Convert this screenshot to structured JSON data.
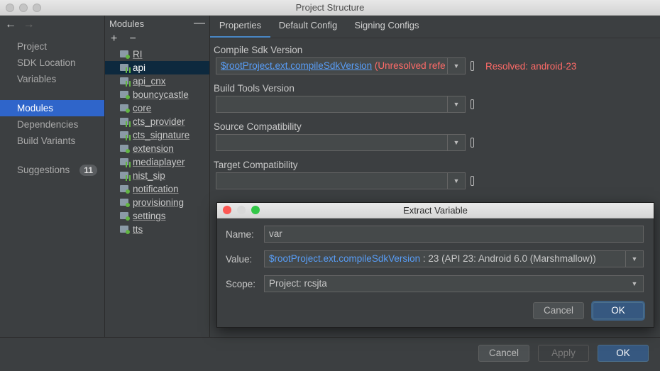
{
  "window": {
    "title": "Project Structure"
  },
  "nav": {
    "back_icon": "arrow-left-icon",
    "forward_icon": "arrow-right-icon",
    "items": [
      {
        "label": "Project"
      },
      {
        "label": "SDK Location"
      },
      {
        "label": "Variables"
      },
      {
        "label": "Modules",
        "selected": true
      },
      {
        "label": "Dependencies"
      },
      {
        "label": "Build Variants"
      },
      {
        "label": "Suggestions",
        "badge": "11"
      }
    ]
  },
  "modules": {
    "header": "Modules",
    "add": "+",
    "remove": "−",
    "minimize": "—",
    "items": [
      {
        "name": "RI",
        "kind": "java"
      },
      {
        "name": "api",
        "kind": "android",
        "selected": true
      },
      {
        "name": "api_cnx",
        "kind": "android"
      },
      {
        "name": "bouncycastle",
        "kind": "java"
      },
      {
        "name": "core",
        "kind": "java"
      },
      {
        "name": "cts_provider",
        "kind": "android"
      },
      {
        "name": "cts_signature",
        "kind": "android"
      },
      {
        "name": "extension",
        "kind": "java"
      },
      {
        "name": "mediaplayer",
        "kind": "android"
      },
      {
        "name": "nist_sip",
        "kind": "android"
      },
      {
        "name": "notification",
        "kind": "java"
      },
      {
        "name": "provisioning",
        "kind": "java"
      },
      {
        "name": "settings",
        "kind": "java"
      },
      {
        "name": "tts",
        "kind": "java"
      }
    ]
  },
  "tabs": [
    {
      "label": "Properties",
      "active": true
    },
    {
      "label": "Default Config"
    },
    {
      "label": "Signing Configs"
    }
  ],
  "properties": {
    "compile_sdk": {
      "label": "Compile Sdk Version",
      "value_link": "$rootProject.ext.compileSdkVersion",
      "value_error": " (Unresolved reference: compileSdkVersion)",
      "resolved": "Resolved: android-23"
    },
    "build_tools": {
      "label": "Build Tools Version",
      "value": ""
    },
    "source_compat": {
      "label": "Source Compatibility",
      "value": ""
    },
    "target_compat": {
      "label": "Target Compatibility",
      "value": ""
    }
  },
  "dialog": {
    "title": "Extract Variable",
    "name_label": "Name:",
    "name_value": "var",
    "value_label": "Value:",
    "value_link": "$rootProject.ext.compileSdkVersion",
    "value_rest": " : 23 (API 23: Android 6.0 (Marshmallow))",
    "scope_label": "Scope:",
    "scope_value": "Project: rcsjta",
    "cancel": "Cancel",
    "ok": "OK",
    "colors": {
      "close": "#fc5753",
      "minimize": "#d8d8d8",
      "zoom": "#33c748"
    }
  },
  "footer": {
    "cancel": "Cancel",
    "apply": "Apply",
    "ok": "OK"
  },
  "colors": {
    "accent": "#2f65ca",
    "primary_button": "#365880",
    "error": "#ff6b68",
    "link": "#589df6"
  }
}
